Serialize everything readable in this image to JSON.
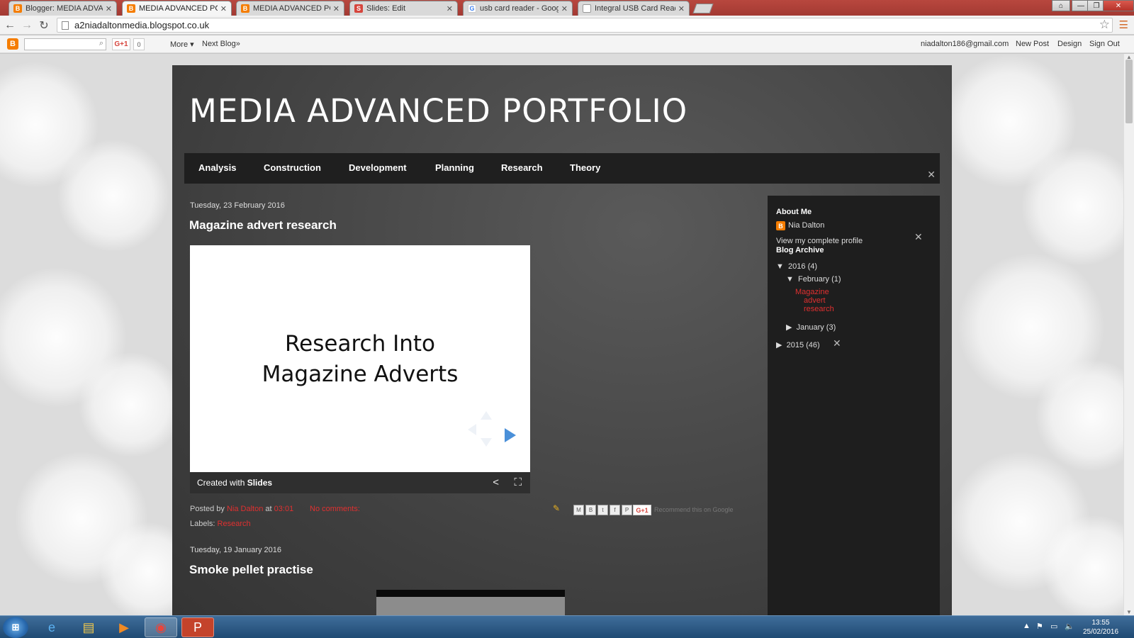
{
  "browser": {
    "tabs": [
      {
        "title": "Blogger: MEDIA ADVANCE",
        "icon": "blogger-icon"
      },
      {
        "title": "MEDIA ADVANCED PORTF",
        "icon": "blogger-icon",
        "active": true
      },
      {
        "title": "MEDIA ADVANCED PORTF",
        "icon": "blogger-icon"
      },
      {
        "title": "Slides: Edit",
        "icon": "slides-icon"
      },
      {
        "title": "usb card reader - Google S",
        "icon": "google-icon"
      },
      {
        "title": "Integral USB Card Reader",
        "icon": "document-icon"
      }
    ],
    "url": "a2niadaltonmedia.blogspot.co.uk"
  },
  "navbar": {
    "count": "0",
    "more": "More ▾",
    "next_blog": "Next Blog»",
    "email": "niadalton186@gmail.com",
    "new_post": "New Post",
    "design": "Design",
    "sign_out": "Sign Out"
  },
  "blog": {
    "title": "MEDIA ADVANCED PORTFOLIO",
    "tabs": [
      "Analysis",
      "Construction",
      "Development",
      "Planning",
      "Research",
      "Theory"
    ]
  },
  "posts": [
    {
      "date": "Tuesday, 23 February 2016",
      "title": "Magazine advert research",
      "slide_line1": "Research Into",
      "slide_line2": "Magazine Adverts",
      "created_with": "Created with",
      "created_with_brand": "Slides",
      "posted_by_label": "Posted by",
      "author": "Nia Dalton",
      "at": "at",
      "time": "03:01",
      "comments": "No comments:",
      "recommend": "Recommend this on Google",
      "labels_label": "Labels:",
      "label": "Research"
    },
    {
      "date": "Tuesday, 19 January 2016",
      "title": "Smoke pellet practise"
    }
  ],
  "sidebar": {
    "about_heading": "About Me",
    "profile_name": "Nia Dalton",
    "profile_link": "View my complete profile",
    "archive_heading": "Blog Archive",
    "archive": {
      "y2016": "2016",
      "y2016_count": "(4)",
      "feb": "February",
      "feb_count": "(1)",
      "feb_post_1": "Magazine",
      "feb_post_2": "advert",
      "feb_post_3": "research",
      "jan": "January",
      "jan_count": "(3)",
      "y2015": "2015",
      "y2015_count": "(46)"
    }
  },
  "taskbar": {
    "time": "13:55",
    "date": "25/02/2016"
  },
  "colors": {
    "accent_red": "#e03030",
    "blogger_orange": "#f57d00",
    "tab_strip": "#a33a33",
    "blog_bg": "#3e3e3e"
  }
}
